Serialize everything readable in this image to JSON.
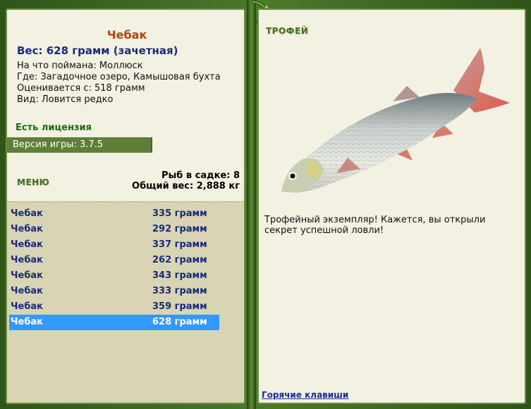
{
  "fish": {
    "name": "Чебак",
    "weight": "Вес: 628 грамм (зачетная)",
    "info": [
      "На что поймана: Моллюск",
      "Где: Загадочное озеро, Камышовая бухта",
      "Оценивается с: 518 грамм",
      "Вид: Ловится редко"
    ]
  },
  "license": "Есть лицензия",
  "version": "Версия игры: 3.7.5",
  "menu_label": "МЕНЮ",
  "stats": {
    "count": "Рыб в садке: 8",
    "total": "Общий вес: 2,888 кг"
  },
  "catch_list": [
    {
      "name": "Чебак",
      "weight": "335 грамм"
    },
    {
      "name": "Чебак",
      "weight": "292 грамм"
    },
    {
      "name": "Чебак",
      "weight": "337 грамм"
    },
    {
      "name": "Чебак",
      "weight": "262 грамм"
    },
    {
      "name": "Чебак",
      "weight": "343 грамм"
    },
    {
      "name": "Чебак",
      "weight": "333 грамм"
    },
    {
      "name": "Чебак",
      "weight": "359 грамм"
    },
    {
      "name": "Чебак",
      "weight": "628 грамм"
    }
  ],
  "selected_index": 7,
  "trophy_label": "ТРОФЕЙ",
  "trophy_text": "Трофейный экземпляр! Кажется, вы открыли секрет успешной ловли!",
  "hotkeys": "Горячие клавиши",
  "colors": {
    "frame": "#3f6a25",
    "panel": "#f3f1e2",
    "selected": "#3399ff",
    "title": "#b8400a",
    "link": "#1a2a9a"
  }
}
